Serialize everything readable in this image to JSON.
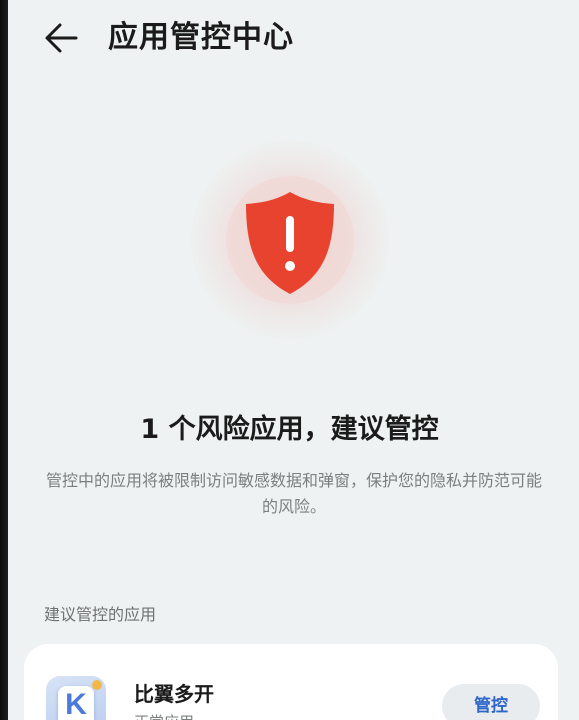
{
  "header": {
    "title": "应用管控中心",
    "back_icon": "arrow-left-icon"
  },
  "status": {
    "shield_icon": "shield-alert-icon",
    "shield_color": "#e8432e",
    "headline": "1 个风险应用，建议管控",
    "description": "管控中的应用将被限制访问敏感数据和弹窗，保护您的隐私并防范可能的风险。"
  },
  "section": {
    "label": "建议管控的应用"
  },
  "apps": [
    {
      "name": "比翼多开",
      "subtitle": "正常应用",
      "icon": "biyi-duokai-app-icon",
      "action_label": "管控"
    }
  ],
  "colors": {
    "background": "#eef2f2",
    "accent": "#2f66c9",
    "danger": "#e8432e"
  }
}
